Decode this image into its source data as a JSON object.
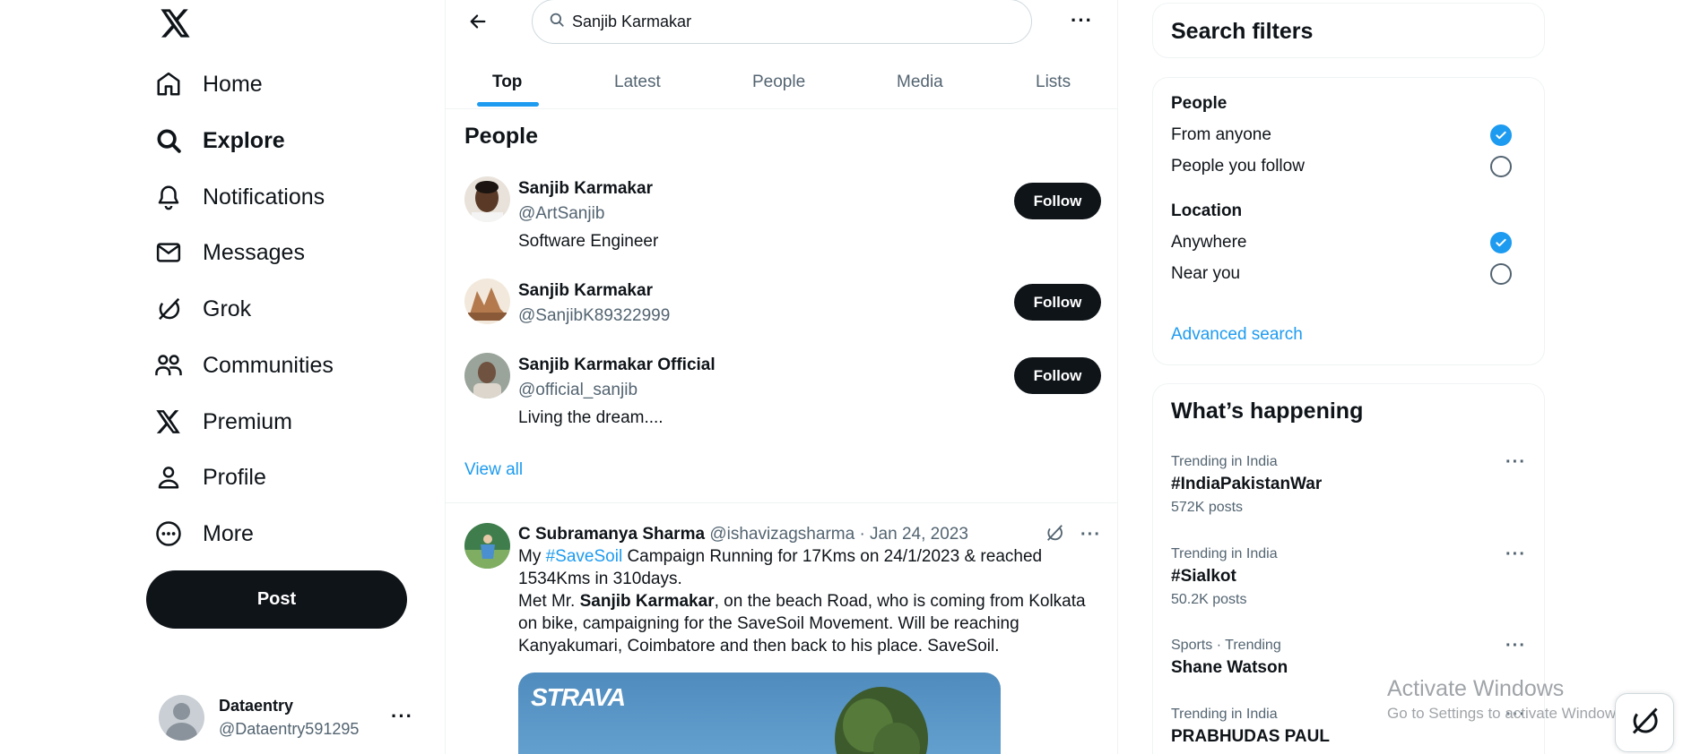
{
  "nav": {
    "items": [
      {
        "label": "Home",
        "icon": "home-icon"
      },
      {
        "label": "Explore",
        "icon": "search-icon"
      },
      {
        "label": "Notifications",
        "icon": "bell-icon"
      },
      {
        "label": "Messages",
        "icon": "mail-icon"
      },
      {
        "label": "Grok",
        "icon": "grok-icon"
      },
      {
        "label": "Communities",
        "icon": "communities-icon"
      },
      {
        "label": "Premium",
        "icon": "x-logo-icon"
      },
      {
        "label": "Profile",
        "icon": "person-icon"
      },
      {
        "label": "More",
        "icon": "more-circle-icon"
      }
    ],
    "active": "Explore",
    "post_label": "Post",
    "account": {
      "name": "Dataentry",
      "handle": "@Dataentry591295"
    }
  },
  "search": {
    "value": "Sanjib Karmakar"
  },
  "tabs": [
    "Top",
    "Latest",
    "People",
    "Media",
    "Lists"
  ],
  "active_tab": "Top",
  "people_section": {
    "title": "People",
    "people": [
      {
        "name": "Sanjib Karmakar",
        "handle": "@ArtSanjib",
        "bio": "Software Engineer",
        "follow": "Follow"
      },
      {
        "name": "Sanjib Karmakar",
        "handle": "@SanjibK89322999",
        "bio": "",
        "follow": "Follow"
      },
      {
        "name": "Sanjib Karmakar Official",
        "handle": "@official_sanjib",
        "bio": "Living the dream....",
        "follow": "Follow"
      }
    ],
    "view_all": "View all"
  },
  "tweet": {
    "name": "C Subramanya Sharma",
    "handle": "@ishavizagsharma",
    "date": "· Jan 24, 2023",
    "line1_pre": "My ",
    "hashtag": "#SaveSoil",
    "line1_post": " Campaign Running for 17Kms on 24/1/2023 & reached 1534Kms in 310days.",
    "line2_pre": "Met Mr. ",
    "line2_bold": "Sanjib Karmakar",
    "line2_post": ", on the beach Road, who is coming from Kolkata on bike, campaigning for the SaveSoil Movement. Will be reaching Kanyakumari, Coimbatore and then back to his place. SaveSoil.",
    "media_brand": "STRAVA"
  },
  "filters": {
    "title": "Search filters",
    "people_head": "People",
    "people_opts": [
      {
        "label": "From anyone",
        "checked": true
      },
      {
        "label": "People you follow",
        "checked": false
      }
    ],
    "location_head": "Location",
    "location_opts": [
      {
        "label": "Anywhere",
        "checked": true
      },
      {
        "label": "Near you",
        "checked": false
      }
    ],
    "advanced": "Advanced search"
  },
  "happening": {
    "title": "What’s happening",
    "trends": [
      {
        "category": "Trending in India",
        "name": "#IndiaPakistanWar",
        "posts": "572K posts"
      },
      {
        "category": "Trending in India",
        "name": "#Sialkot",
        "posts": "50.2K posts"
      },
      {
        "category": "Sports · Trending",
        "name": "Shane Watson",
        "posts": ""
      },
      {
        "category": "Trending in India",
        "name": "PRABHUDAS PAUL",
        "posts": ""
      }
    ]
  },
  "watermark": {
    "line1": "Activate Windows",
    "line2": "Go to Settings to activate Windows."
  },
  "colors": {
    "accent": "#1d9bf0",
    "text": "#0f1419",
    "muted": "#536471"
  }
}
